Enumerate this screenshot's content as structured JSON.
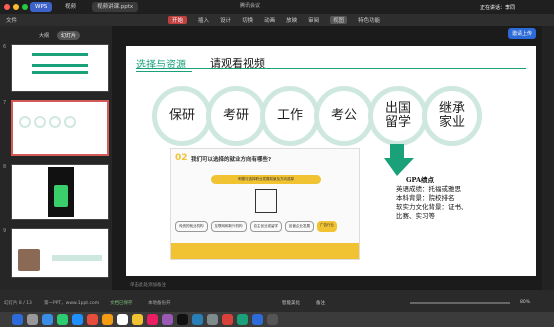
{
  "window": {
    "tabs": [
      {
        "label": "WPS"
      },
      {
        "label": "视频"
      },
      {
        "label": "视频讲课.pptx"
      }
    ],
    "meeting_title": "腾讯会议",
    "screen_share_status": "正在讲话：李同"
  },
  "menu": {
    "file_label": "文件",
    "items": [
      "开始",
      "插入",
      "设计",
      "切换",
      "动画",
      "放映",
      "审阅",
      "视图",
      "特色功能"
    ],
    "active": "开始",
    "share_button": "邀请上传"
  },
  "left_panel": {
    "view_tabs": [
      "大纲",
      "幻灯片"
    ],
    "active_view": "幻灯片",
    "slide_numbers": [
      "6",
      "7",
      "8",
      "9",
      "10"
    ]
  },
  "slide": {
    "heading": "选择与资源",
    "subheading": "请观看视频",
    "circles": [
      {
        "label": "保研"
      },
      {
        "label": "考研"
      },
      {
        "label": "工作"
      },
      {
        "label": "考公"
      },
      {
        "label": "出国\n留学"
      },
      {
        "label": "继承\n家业"
      }
    ],
    "embedded_card": {
      "number": "02",
      "question": "我们可以选择的就业方向有哪些?",
      "subtitle": "明德与选择职业发展前景及方向选择",
      "options": [
        "传统的就业机构",
        "互联网和新兴机构",
        "自主创业或留学",
        "民营企业发展",
        "广告行业"
      ]
    },
    "gpa_note": {
      "title": "GPA绩点",
      "lines": [
        "英语成绩：托福或雅思",
        "本科背景：院校排名",
        "软实力文化背景：证书、",
        "比赛、实习等"
      ]
    },
    "notes_placeholder": "单击此处添加备注"
  },
  "status_bar": {
    "slide_indicator": "幻灯片 8 / 13",
    "theme": "第一PPT，www.1ppt.com",
    "doc_status": "文档已保存",
    "check": "本地备份开",
    "smart_beautify": "智能美化",
    "notes": "备注",
    "zoom": "80%"
  },
  "colors": {
    "accent_green": "#1aa17a",
    "circle_border": "#cfe8df",
    "ribbon_active": "#c14040",
    "card_yellow": "#f1c232"
  }
}
